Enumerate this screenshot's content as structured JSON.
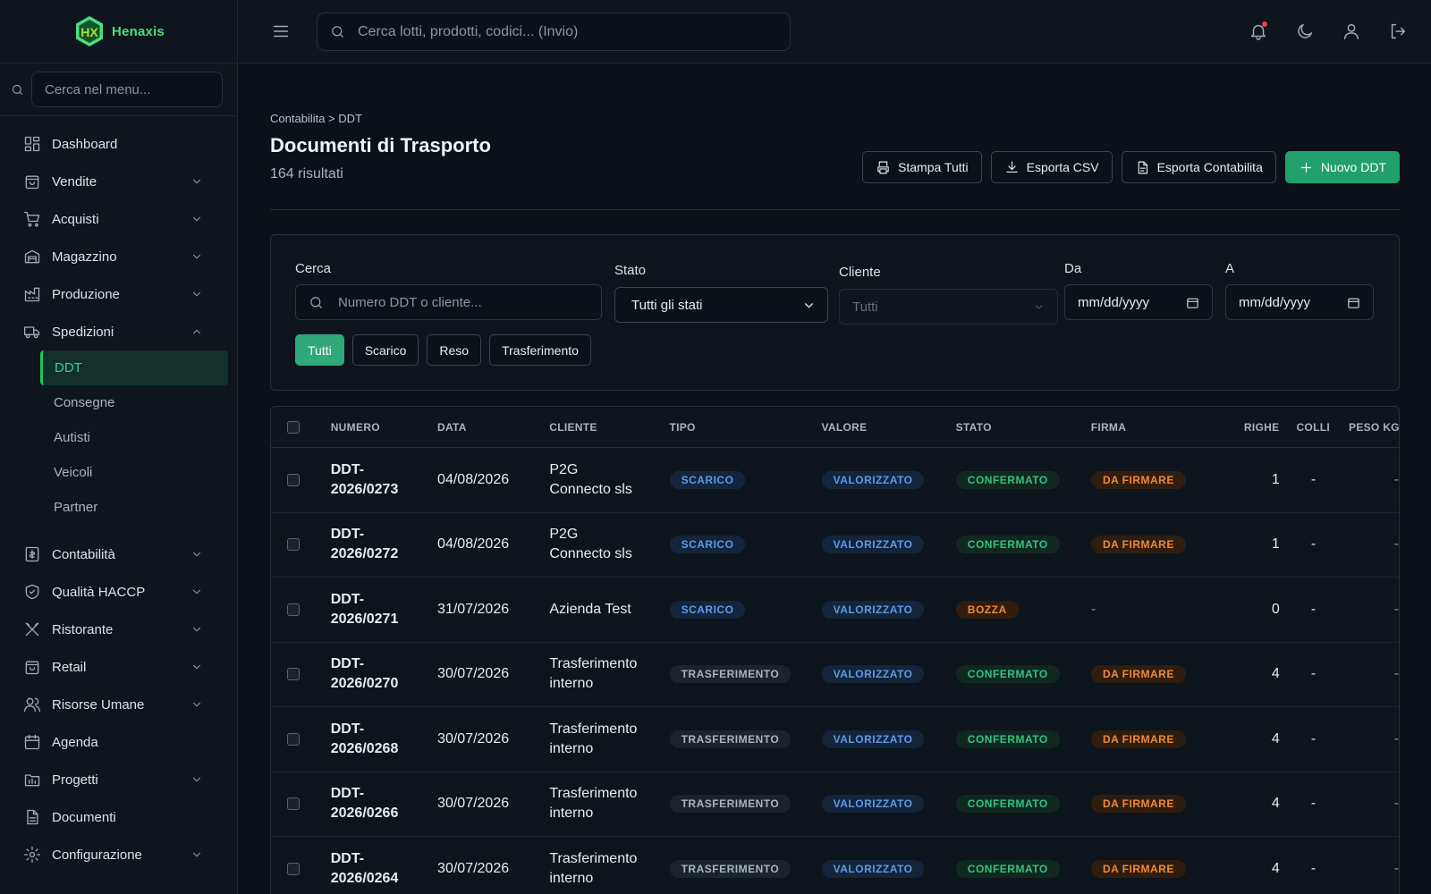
{
  "app": {
    "name": "Henaxis",
    "logo_mark": "HX"
  },
  "sidebar": {
    "search_placeholder": "Cerca nel menu...",
    "items": [
      {
        "label": "Dashboard",
        "icon": "dashboard-icon",
        "expandable": false
      },
      {
        "label": "Vendite",
        "icon": "shopping-bag-icon",
        "expandable": true
      },
      {
        "label": "Acquisti",
        "icon": "cart-icon",
        "expandable": true
      },
      {
        "label": "Magazzino",
        "icon": "warehouse-icon",
        "expandable": true
      },
      {
        "label": "Produzione",
        "icon": "factory-icon",
        "expandable": true
      },
      {
        "label": "Spedizioni",
        "icon": "truck-icon",
        "expandable": true,
        "expanded": true
      }
    ],
    "sub_items": [
      "DDT",
      "Consegne",
      "Autisti",
      "Veicoli",
      "Partner"
    ],
    "active_sub": "DDT",
    "items_after": [
      {
        "label": "Contabilità",
        "icon": "accounting-icon",
        "expandable": true
      },
      {
        "label": "Qualità HACCP",
        "icon": "shield-check-icon",
        "expandable": true
      },
      {
        "label": "Ristorante",
        "icon": "utensils-icon",
        "expandable": true
      },
      {
        "label": "Retail",
        "icon": "store-bag-icon",
        "expandable": true
      },
      {
        "label": "Risorse Umane",
        "icon": "users-icon",
        "expandable": true
      },
      {
        "label": "Agenda",
        "icon": "calendar-icon",
        "expandable": false
      },
      {
        "label": "Progetti",
        "icon": "folder-icon",
        "expandable": true
      },
      {
        "label": "Documenti",
        "icon": "document-icon",
        "expandable": false
      },
      {
        "label": "Configurazione",
        "icon": "gear-icon",
        "expandable": true
      }
    ]
  },
  "topbar": {
    "search_placeholder": "Cerca lotti, prodotti, codici... (Invio)",
    "icons": [
      "bell-icon",
      "moon-icon",
      "user-icon",
      "logout-icon"
    ]
  },
  "page": {
    "breadcrumb": "Contabilita > DDT",
    "title": "Documenti di Trasporto",
    "result_count": "164 risultati",
    "actions": {
      "print_all": "Stampa Tutti",
      "export_csv": "Esporta CSV",
      "export_accounting": "Esporta Contabilita",
      "new_ddt": "Nuovo DDT"
    }
  },
  "filters": {
    "search_label": "Cerca",
    "search_placeholder": "Numero DDT o cliente...",
    "status_label": "Stato",
    "status_value": "Tutti gli stati",
    "client_label": "Cliente",
    "client_value": "Tutti",
    "from_label": "Da",
    "from_value": "mm/dd/yyyy",
    "to_label": "A",
    "to_value": "mm/dd/yyyy",
    "type_chips": [
      "Tutti",
      "Scarico",
      "Reso",
      "Trasferimento"
    ],
    "active_chip": "Tutti"
  },
  "table": {
    "columns": [
      "NUMERO",
      "DATA",
      "CLIENTE",
      "TIPO",
      "VALORE",
      "STATO",
      "FIRMA",
      "RIGHE",
      "COLLI",
      "PESO KG"
    ],
    "rows": [
      {
        "numero_1": "DDT-",
        "numero_2": "2026/0273",
        "data": "04/08/2026",
        "cliente_1": "P2G",
        "cliente_2": "Connecto sls",
        "tipo": "SCARICO",
        "valore": "VALORIZZATO",
        "stato": "CONFERMATO",
        "firma": "DA FIRMARE",
        "righe": "1",
        "colli": "-",
        "peso": "-"
      },
      {
        "numero_1": "DDT-",
        "numero_2": "2026/0272",
        "data": "04/08/2026",
        "cliente_1": "P2G",
        "cliente_2": "Connecto sls",
        "tipo": "SCARICO",
        "valore": "VALORIZZATO",
        "stato": "CONFERMATO",
        "firma": "DA FIRMARE",
        "righe": "1",
        "colli": "-",
        "peso": "-"
      },
      {
        "numero_1": "DDT-",
        "numero_2": "2026/0271",
        "data": "31/07/2026",
        "cliente_1": "Azienda Test",
        "cliente_2": "",
        "tipo": "SCARICO",
        "valore": "VALORIZZATO",
        "stato": "BOZZA",
        "firma": "-",
        "righe": "0",
        "colli": "-",
        "peso": "-"
      },
      {
        "numero_1": "DDT-",
        "numero_2": "2026/0270",
        "data": "30/07/2026",
        "cliente_1": "Trasferimento",
        "cliente_2": "interno",
        "tipo": "TRASFERIMENTO",
        "valore": "VALORIZZATO",
        "stato": "CONFERMATO",
        "firma": "DA FIRMARE",
        "righe": "4",
        "colli": "-",
        "peso": "-"
      },
      {
        "numero_1": "DDT-",
        "numero_2": "2026/0268",
        "data": "30/07/2026",
        "cliente_1": "Trasferimento",
        "cliente_2": "interno",
        "tipo": "TRASFERIMENTO",
        "valore": "VALORIZZATO",
        "stato": "CONFERMATO",
        "firma": "DA FIRMARE",
        "righe": "4",
        "colli": "-",
        "peso": "-"
      },
      {
        "numero_1": "DDT-",
        "numero_2": "2026/0266",
        "data": "30/07/2026",
        "cliente_1": "Trasferimento",
        "cliente_2": "interno",
        "tipo": "TRASFERIMENTO",
        "valore": "VALORIZZATO",
        "stato": "CONFERMATO",
        "firma": "DA FIRMARE",
        "righe": "4",
        "colli": "-",
        "peso": "-"
      },
      {
        "numero_1": "DDT-",
        "numero_2": "2026/0264",
        "data": "30/07/2026",
        "cliente_1": "Trasferimento",
        "cliente_2": "interno",
        "tipo": "TRASFERIMENTO",
        "valore": "VALORIZZATO",
        "stato": "CONFERMATO",
        "firma": "DA FIRMARE",
        "righe": "4",
        "colli": "-",
        "peso": "-"
      }
    ]
  },
  "colors": {
    "accent": "#22a06b",
    "background": "#0b1118",
    "sidebar": "#0e151d",
    "badge_blue": "#5b9be8",
    "badge_green": "#34c084",
    "badge_orange": "#f08a32"
  }
}
